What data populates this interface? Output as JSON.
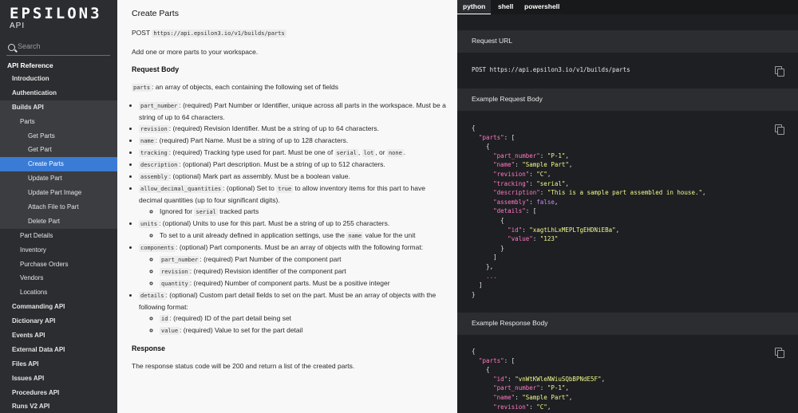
{
  "sidebar": {
    "logo": "EPSILON3",
    "logo_sub": "API",
    "search_placeholder": "Search",
    "heading": "API Reference",
    "items": [
      {
        "label": "Introduction",
        "level": 1
      },
      {
        "label": "Authentication",
        "level": 1
      },
      {
        "label": "Builds API",
        "level": 1,
        "state": "open"
      },
      {
        "label": "Parts",
        "level": 2,
        "state": "open"
      },
      {
        "label": "Get Parts",
        "level": 3,
        "state": "open"
      },
      {
        "label": "Get Part",
        "level": 3,
        "state": "open"
      },
      {
        "label": "Create Parts",
        "level": 3,
        "state": "active"
      },
      {
        "label": "Update Part",
        "level": 3,
        "state": "open"
      },
      {
        "label": "Update Part Image",
        "level": 3,
        "state": "open"
      },
      {
        "label": "Attach File to Part",
        "level": 3,
        "state": "open"
      },
      {
        "label": "Delete Part",
        "level": 3,
        "state": "open"
      },
      {
        "label": "Part Details",
        "level": 2
      },
      {
        "label": "Inventory",
        "level": 2
      },
      {
        "label": "Purchase Orders",
        "level": 2
      },
      {
        "label": "Vendors",
        "level": 2
      },
      {
        "label": "Locations",
        "level": 2
      },
      {
        "label": "Commanding API",
        "level": 1
      },
      {
        "label": "Dictionary API",
        "level": 1
      },
      {
        "label": "Events API",
        "level": 1
      },
      {
        "label": "External Data API",
        "level": 1
      },
      {
        "label": "Files API",
        "level": 1
      },
      {
        "label": "Issues API",
        "level": 1
      },
      {
        "label": "Procedures API",
        "level": 1
      },
      {
        "label": "Runs V2 API",
        "level": 1
      }
    ]
  },
  "main": {
    "title": "Create Parts",
    "method": "POST",
    "url": "https://api.epsilon3.io/v1/builds/parts",
    "intro": "Add one or more parts to your workspace.",
    "request_body_heading": "Request Body",
    "parts_code": "parts",
    "parts_desc": ": an array of objects, each containing the following set of fields",
    "fields": [
      {
        "code": "part_number",
        "text": ": (required) Part Number or Identifier, unique across all parts in the workspace. Must be a string of up to 64 characters."
      },
      {
        "code": "revision",
        "text": ": (required) Revision Identifier. Must be a string of up to 64 characters."
      },
      {
        "code": "name",
        "text": ": (required) Part Name. Must be a string of up to 128 characters."
      },
      {
        "code": "description",
        "text": ": (optional) Part description. Must be a string of up to 512 characters."
      },
      {
        "code": "assembly",
        "text": ": (optional) Mark part as assembly. Must be a boolean value."
      },
      {
        "code": "units",
        "text": ": (optional) Units to use for this part. Must be a string of up to 255 characters."
      }
    ],
    "tracking": {
      "code": "tracking",
      "text1": ": (required) Tracking type used for part. Must be one of ",
      "opt1": "serial",
      "sep": ", ",
      "opt2": "lot",
      "sep2": ", or ",
      "opt3": "none",
      "end": "."
    },
    "decimal": {
      "code": "allow_decimal_quantities",
      "text1": ": (optional) Set to ",
      "val": "true",
      "text2": " to allow inventory items for this part to have decimal quantities (up to four significant digits).",
      "sub_pre": "Ignored for ",
      "sub_code": "serial",
      "sub_post": " tracked parts"
    },
    "units_sub": {
      "pre": "To set to a unit already defined in application settings, use the ",
      "code": "name",
      "post": " value for the unit"
    },
    "components": {
      "code": "components",
      "text": ": (optional) Part components. Must be an array of objects with the following format:",
      "subs": [
        {
          "code": "part_number",
          "text": ": (required) Part Number of the component part"
        },
        {
          "code": "revision",
          "text": ": (required) Revision identifier of the component part"
        },
        {
          "code": "quantity",
          "text": ": (required) Number of component parts. Must be a positive integer"
        }
      ]
    },
    "details": {
      "code": "details",
      "text": ": (optional) Custom part detail fields to set on the part. Must be an array of objects with the following format:",
      "subs": [
        {
          "code": "id",
          "text": ": (required) ID of the part detail being set"
        },
        {
          "code": "value",
          "text": ": (required) Value to set for the part detail"
        }
      ]
    },
    "response_heading": "Response",
    "response_text": "The response status code will be 200 and return a list of the created parts."
  },
  "codepanel": {
    "tabs": [
      "python",
      "shell",
      "powershell"
    ],
    "active_tab": "python",
    "request_url_label": "Request URL",
    "request_url": "POST https://api.epsilon3.io/v1/builds/parts",
    "request_body_label": "Example Request Body",
    "request_body": {
      "parts": "\"parts\"",
      "part_number_k": "\"part_number\"",
      "part_number_v": "\"P-1\"",
      "name_k": "\"name\"",
      "name_v": "\"Sample Part\"",
      "revision_k": "\"revision\"",
      "revision_v": "\"C\"",
      "tracking_k": "\"tracking\"",
      "tracking_v": "\"serial\"",
      "description_k": "\"description\"",
      "description_v": "\"This is a sample part assembled in house.\"",
      "assembly_k": "\"assembly\"",
      "assembly_v": "false",
      "details_k": "\"details\"",
      "id_k": "\"id\"",
      "id_v": "\"xagtLhLxMEPLTgEHDNiEBa\"",
      "value_k": "\"value\"",
      "value_v": "\"123\"",
      "ellipsis": "..."
    },
    "response_body_label": "Example Response Body",
    "response_body": {
      "parts": "\"parts\"",
      "id_k": "\"id\"",
      "id_v": "\"vnWtKWleNWiuSQbBPNdE5F\"",
      "part_number_k": "\"part_number\"",
      "part_number_v": "\"P-1\"",
      "name_k": "\"name\"",
      "name_v": "\"Sample Part\"",
      "revision_k": "\"revision\"",
      "revision_v": "\"C\""
    }
  }
}
